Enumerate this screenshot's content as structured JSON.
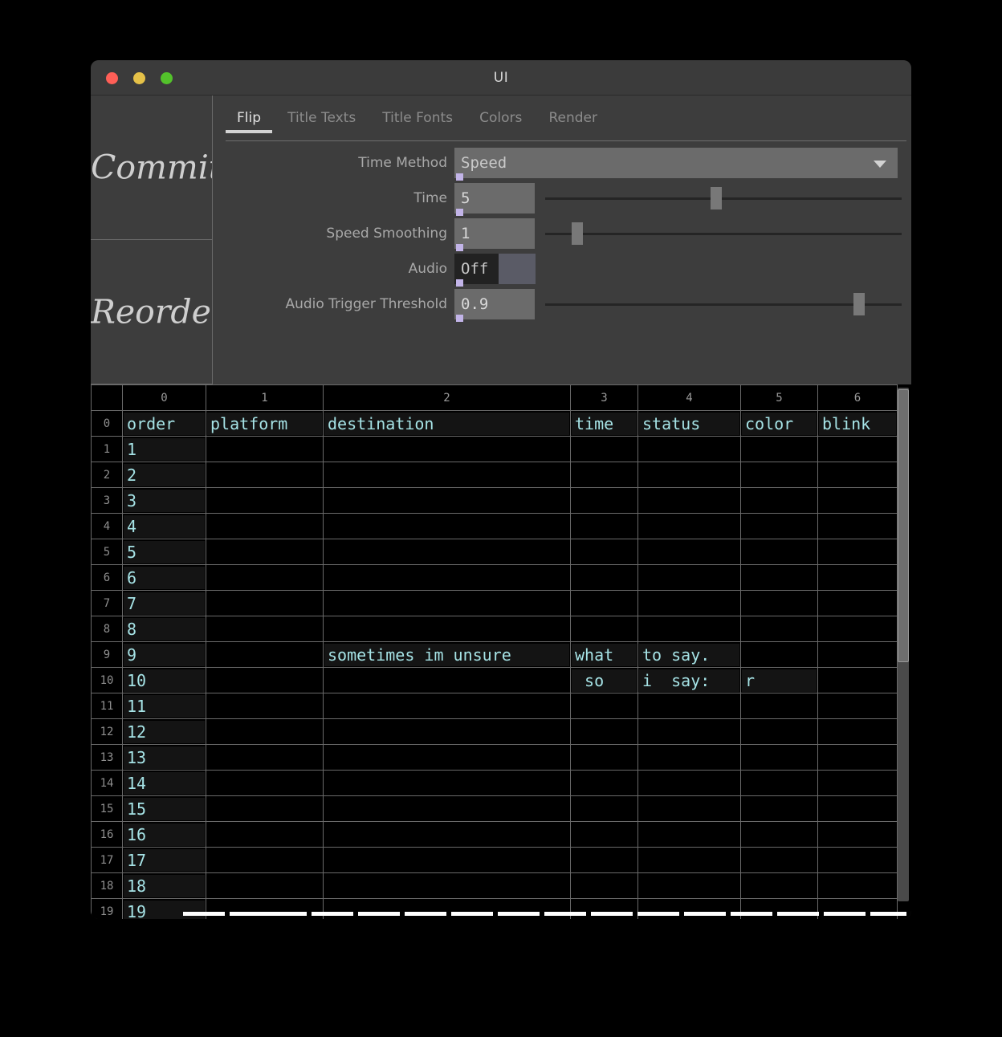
{
  "window": {
    "title": "UI",
    "traffic_lights": [
      {
        "name": "close",
        "color": "#ff5f57"
      },
      {
        "name": "minimize",
        "color": "#e5c148"
      },
      {
        "name": "maximize",
        "color": "#53c22b"
      }
    ]
  },
  "sidebar": {
    "buttons": [
      {
        "label": "Commit"
      },
      {
        "label": "Reorder"
      }
    ]
  },
  "tabs": [
    {
      "label": "Flip",
      "active": true
    },
    {
      "label": "Title Texts",
      "active": false
    },
    {
      "label": "Title Fonts",
      "active": false
    },
    {
      "label": "Colors",
      "active": false
    },
    {
      "label": "Render",
      "active": false
    }
  ],
  "controls": {
    "time_method": {
      "label": "Time Method",
      "value": "Speed",
      "type": "dropdown"
    },
    "time": {
      "label": "Time",
      "value": "5",
      "type": "slider",
      "thumb_pct": 48
    },
    "speed_smoothing": {
      "label": "Speed Smoothing",
      "value": "1",
      "type": "slider",
      "thumb_pct": 9
    },
    "audio": {
      "label": "Audio",
      "value": "Off",
      "type": "toggle",
      "swatch_color": "#5a5b66"
    },
    "audio_trigger_threshold": {
      "label": "Audio Trigger Threshold",
      "value": "0.9",
      "type": "slider",
      "thumb_pct": 88
    }
  },
  "table": {
    "column_headers": [
      "",
      "0",
      "1",
      "2",
      "3",
      "4",
      "5",
      "6"
    ],
    "row_indices": [
      "0",
      "1",
      "2",
      "3",
      "4",
      "5",
      "6",
      "7",
      "8",
      "9",
      "10",
      "11",
      "12",
      "13",
      "14",
      "15",
      "16",
      "17",
      "18",
      "19"
    ],
    "rows": [
      {
        "index": "0",
        "cells": [
          "order",
          "platform",
          "destination",
          "time",
          "status",
          "color",
          "blink"
        ]
      },
      {
        "index": "1",
        "cells": [
          "1",
          "",
          "",
          "",
          "",
          "",
          ""
        ]
      },
      {
        "index": "2",
        "cells": [
          "2",
          "",
          "",
          "",
          "",
          "",
          ""
        ]
      },
      {
        "index": "3",
        "cells": [
          "3",
          "",
          "",
          "",
          "",
          "",
          ""
        ]
      },
      {
        "index": "4",
        "cells": [
          "4",
          "",
          "",
          "",
          "",
          "",
          ""
        ]
      },
      {
        "index": "5",
        "cells": [
          "5",
          "",
          "",
          "",
          "",
          "",
          ""
        ]
      },
      {
        "index": "6",
        "cells": [
          "6",
          "",
          "",
          "",
          "",
          "",
          ""
        ]
      },
      {
        "index": "7",
        "cells": [
          "7",
          "",
          "",
          "",
          "",
          "",
          ""
        ]
      },
      {
        "index": "8",
        "cells": [
          "8",
          "",
          "",
          "",
          "",
          "",
          ""
        ]
      },
      {
        "index": "9",
        "cells": [
          "9",
          "",
          "sometimes im unsure",
          "what",
          "to say.",
          "",
          ""
        ]
      },
      {
        "index": "10",
        "cells": [
          "10",
          "",
          "",
          " so",
          "i  say:",
          "r",
          ""
        ]
      },
      {
        "index": "11",
        "cells": [
          "11",
          "",
          "",
          "",
          "",
          "",
          ""
        ]
      },
      {
        "index": "12",
        "cells": [
          "12",
          "",
          "",
          "",
          "",
          "",
          ""
        ]
      },
      {
        "index": "13",
        "cells": [
          "13",
          "",
          "",
          "",
          "",
          "",
          ""
        ]
      },
      {
        "index": "14",
        "cells": [
          "14",
          "",
          "",
          "",
          "",
          "",
          ""
        ]
      },
      {
        "index": "15",
        "cells": [
          "15",
          "",
          "",
          "",
          "",
          "",
          ""
        ]
      },
      {
        "index": "16",
        "cells": [
          "16",
          "",
          "",
          "",
          "",
          "",
          ""
        ]
      },
      {
        "index": "17",
        "cells": [
          "17",
          "",
          "",
          "",
          "",
          "",
          ""
        ]
      },
      {
        "index": "18",
        "cells": [
          "18",
          "",
          "",
          "",
          "",
          "",
          ""
        ]
      },
      {
        "index": "19",
        "cells": [
          "19",
          "",
          "",
          "",
          "",
          "",
          ""
        ]
      }
    ]
  },
  "colors": {
    "cell_text": "#a6e3e6",
    "window_bg": "#3d3d3d",
    "table_bg": "#000000",
    "marker": "#c2b4e8",
    "accent_tab_underline": "#d3d3d3"
  }
}
